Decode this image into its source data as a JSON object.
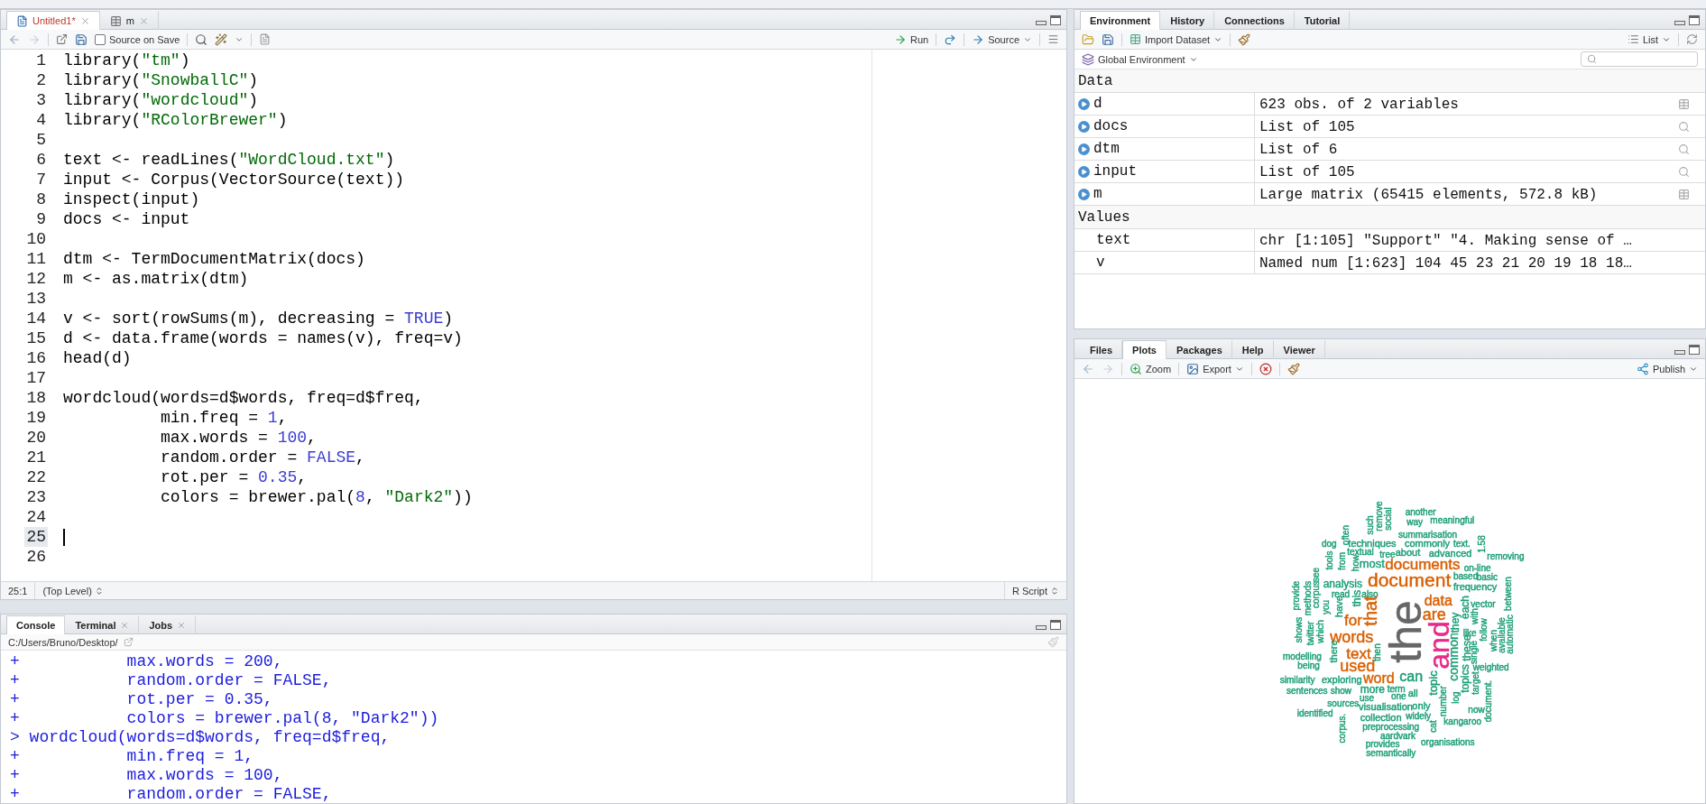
{
  "editor": {
    "tabs": [
      {
        "label": "Untitled1*",
        "kind": "script",
        "selected": true,
        "modified": true
      },
      {
        "label": "m",
        "kind": "data",
        "selected": false,
        "modified": false
      }
    ],
    "toolbar": {
      "source_on_save": {
        "label": "Source on Save",
        "checked": false
      },
      "run": "Run",
      "source": "Source"
    },
    "lines": [
      {
        "n": "1",
        "cursor": false,
        "tokens": [
          {
            "kind": "text",
            "text": "library("
          },
          {
            "kind": "string",
            "text": "\"tm\""
          },
          {
            "kind": "text",
            "text": ")"
          }
        ]
      },
      {
        "n": "2",
        "cursor": false,
        "tokens": [
          {
            "kind": "text",
            "text": "library("
          },
          {
            "kind": "string",
            "text": "\"SnowballC\""
          },
          {
            "kind": "text",
            "text": ")"
          }
        ]
      },
      {
        "n": "3",
        "cursor": false,
        "tokens": [
          {
            "kind": "text",
            "text": "library("
          },
          {
            "kind": "string",
            "text": "\"wordcloud\""
          },
          {
            "kind": "text",
            "text": ")"
          }
        ]
      },
      {
        "n": "4",
        "cursor": false,
        "tokens": [
          {
            "kind": "text",
            "text": "library("
          },
          {
            "kind": "string",
            "text": "\"RColorBrewer\""
          },
          {
            "kind": "text",
            "text": ")"
          }
        ]
      },
      {
        "n": "5",
        "cursor": false
      },
      {
        "n": "6",
        "cursor": false,
        "tokens": [
          {
            "kind": "text",
            "text": "text <- readLines("
          },
          {
            "kind": "string",
            "text": "\"WordCloud.txt\""
          },
          {
            "kind": "text",
            "text": ")"
          }
        ]
      },
      {
        "n": "7",
        "cursor": false,
        "tokens": [
          {
            "kind": "text",
            "text": "input <- Corpus(VectorSource(text))"
          }
        ]
      },
      {
        "n": "8",
        "cursor": false,
        "tokens": [
          {
            "kind": "text",
            "text": "inspect(input)"
          }
        ]
      },
      {
        "n": "9",
        "cursor": false,
        "tokens": [
          {
            "kind": "text",
            "text": "docs <- input"
          }
        ]
      },
      {
        "n": "10",
        "cursor": false
      },
      {
        "n": "11",
        "cursor": false,
        "tokens": [
          {
            "kind": "text",
            "text": "dtm <- TermDocumentMatrix(docs)"
          }
        ]
      },
      {
        "n": "12",
        "cursor": false,
        "tokens": [
          {
            "kind": "text",
            "text": "m <- as.matrix(dtm)"
          }
        ]
      },
      {
        "n": "13",
        "cursor": false
      },
      {
        "n": "14",
        "cursor": false,
        "tokens": [
          {
            "kind": "text",
            "text": "v <- sort(rowSums(m), decreasing = "
          },
          {
            "kind": "number",
            "text": "TRUE"
          },
          {
            "kind": "text",
            "text": ")"
          }
        ]
      },
      {
        "n": "15",
        "cursor": false,
        "tokens": [
          {
            "kind": "text",
            "text": "d <- data.frame(words = names(v), freq=v)"
          }
        ]
      },
      {
        "n": "16",
        "cursor": false,
        "tokens": [
          {
            "kind": "text",
            "text": "head(d)"
          }
        ]
      },
      {
        "n": "17",
        "cursor": false
      },
      {
        "n": "18",
        "cursor": false,
        "tokens": [
          {
            "kind": "text",
            "text": "wordcloud(words=d$words, freq=d$freq,"
          }
        ]
      },
      {
        "n": "19",
        "cursor": false,
        "tokens": [
          {
            "kind": "text",
            "text": "          min.freq = "
          },
          {
            "kind": "number",
            "text": "1"
          },
          {
            "kind": "text",
            "text": ","
          }
        ]
      },
      {
        "n": "20",
        "cursor": false,
        "tokens": [
          {
            "kind": "text",
            "text": "          max.words = "
          },
          {
            "kind": "number",
            "text": "100"
          },
          {
            "kind": "text",
            "text": ","
          }
        ]
      },
      {
        "n": "21",
        "cursor": false,
        "tokens": [
          {
            "kind": "text",
            "text": "          random.order = "
          },
          {
            "kind": "number",
            "text": "FALSE"
          },
          {
            "kind": "text",
            "text": ","
          }
        ]
      },
      {
        "n": "22",
        "cursor": false,
        "tokens": [
          {
            "kind": "text",
            "text": "          rot.per = "
          },
          {
            "kind": "number",
            "text": "0.35"
          },
          {
            "kind": "text",
            "text": ","
          }
        ]
      },
      {
        "n": "23",
        "cursor": false,
        "tokens": [
          {
            "kind": "text",
            "text": "          colors = brewer.pal("
          },
          {
            "kind": "number",
            "text": "8"
          },
          {
            "kind": "text",
            "text": ", "
          },
          {
            "kind": "string",
            "text": "\"Dark2\""
          },
          {
            "kind": "text",
            "text": "))"
          }
        ]
      },
      {
        "n": "24",
        "cursor": false
      },
      {
        "n": "25",
        "cursor": true
      },
      {
        "n": "26",
        "cursor": false
      }
    ],
    "status": {
      "position": "25:1",
      "scope": "(Top Level)",
      "file_type": "R Script"
    }
  },
  "console": {
    "tabs": [
      {
        "label": "Console",
        "selected": true,
        "closable": false
      },
      {
        "label": "Terminal",
        "selected": false,
        "closable": true
      },
      {
        "label": "Jobs",
        "selected": false,
        "closable": true
      }
    ],
    "path": "C:/Users/Bruno/Desktop/",
    "lines": [
      {
        "prompt": "+",
        "text": "          max.words = 200,"
      },
      {
        "prompt": "+",
        "text": "          random.order = FALSE,"
      },
      {
        "prompt": "+",
        "text": "          rot.per = 0.35,"
      },
      {
        "prompt": "+",
        "text": "          colors = brewer.pal(8, \"Dark2\"))"
      },
      {
        "prompt": ">",
        "text": "wordcloud(words=d$words, freq=d$freq,"
      },
      {
        "prompt": "+",
        "text": "          min.freq = 1,"
      },
      {
        "prompt": "+",
        "text": "          max.words = 100,"
      },
      {
        "prompt": "+",
        "text": "          random.order = FALSE,"
      }
    ]
  },
  "environment": {
    "tabs": [
      {
        "label": "Environment",
        "selected": true
      },
      {
        "label": "History",
        "selected": false
      },
      {
        "label": "Connections",
        "selected": false
      },
      {
        "label": "Tutorial",
        "selected": false
      }
    ],
    "import_dataset": "Import Dataset",
    "view_mode": "List",
    "scope": "Global Environment",
    "sections": [
      {
        "title": "Data",
        "rows": [
          {
            "name": "d",
            "value": "623 obs. of 2 variables",
            "expandable": true,
            "kind": "table"
          },
          {
            "name": "docs",
            "value": "List of 105",
            "expandable": true,
            "kind": "list"
          },
          {
            "name": "dtm",
            "value": "List of 6",
            "expandable": true,
            "kind": "list"
          },
          {
            "name": "input",
            "value": "List of 105",
            "expandable": true,
            "kind": "list"
          },
          {
            "name": "m",
            "value": "Large matrix (65415 elements, 572.8 kB)",
            "expandable": true,
            "kind": "table"
          }
        ]
      },
      {
        "title": "Values",
        "rows": [
          {
            "name": "text",
            "value": "chr [1:105] \"Support\" \"4. Making sense of …",
            "expandable": false,
            "kind": "plain"
          },
          {
            "name": "v",
            "value": "Named num [1:623] 104 45 23 21 20 19 18 18…",
            "expandable": false,
            "kind": "plain"
          }
        ]
      }
    ]
  },
  "plots": {
    "tabs": [
      {
        "label": "Files",
        "selected": false
      },
      {
        "label": "Plots",
        "selected": true
      },
      {
        "label": "Packages",
        "selected": false
      },
      {
        "label": "Help",
        "selected": false
      },
      {
        "label": "Viewer",
        "selected": false
      }
    ],
    "zoom": "Zoom",
    "export": "Export",
    "publish": "Publish",
    "wordcloud": [
      {
        "text": "remove",
        "color": "#1b9e77",
        "vertical": true
      },
      {
        "text": "social",
        "color": "#1b9e77",
        "vertical": true
      },
      {
        "text": "another",
        "color": "#1b9e77",
        "vertical": false
      },
      {
        "text": "such",
        "color": "#1b9e77",
        "vertical": true
      },
      {
        "text": "way",
        "color": "#1b9e77",
        "vertical": false
      },
      {
        "text": "meaningful",
        "color": "#1b9e77",
        "vertical": false
      },
      {
        "text": "often",
        "color": "#1b9e77",
        "vertical": true
      },
      {
        "text": "summarisation",
        "color": "#1b9e77",
        "vertical": false
      },
      {
        "text": "dog",
        "color": "#1b9e77",
        "vertical": false
      },
      {
        "text": "techniques",
        "color": "#1b9e77",
        "vertical": false
      },
      {
        "text": "commonly",
        "color": "#1b9e77",
        "vertical": false
      },
      {
        "text": "text.",
        "color": "#1b9e77",
        "vertical": false
      },
      {
        "text": "1.58",
        "color": "#1b9e77",
        "vertical": true
      },
      {
        "text": "tools",
        "color": "#1b9e77",
        "vertical": true
      },
      {
        "text": "textual",
        "color": "#1b9e77",
        "vertical": false
      },
      {
        "text": "about",
        "color": "#1b9e77",
        "vertical": false
      },
      {
        "text": "advanced",
        "color": "#1b9e77",
        "vertical": false
      },
      {
        "text": "from",
        "color": "#1b9e77",
        "vertical": true
      },
      {
        "text": "how",
        "color": "#1b9e77",
        "vertical": true
      },
      {
        "text": "most",
        "color": "#1b9e77",
        "vertical": false
      },
      {
        "text": "tree",
        "color": "#1b9e77",
        "vertical": false
      },
      {
        "text": "documents",
        "color": "#d95f02",
        "vertical": false
      },
      {
        "text": "removing",
        "color": "#1b9e77",
        "vertical": false
      },
      {
        "text": "on-line",
        "color": "#1b9e77",
        "vertical": false
      },
      {
        "text": "see",
        "color": "#1b9e77",
        "vertical": true
      },
      {
        "text": "document",
        "color": "#d95f02",
        "vertical": false
      },
      {
        "text": "based",
        "color": "#1b9e77",
        "vertical": false
      },
      {
        "text": "basic",
        "color": "#1b9e77",
        "vertical": false
      },
      {
        "text": "provide",
        "color": "#1b9e77",
        "vertical": true
      },
      {
        "text": "corpus",
        "color": "#1b9e77",
        "vertical": true
      },
      {
        "text": "analysis",
        "color": "#1b9e77",
        "vertical": false
      },
      {
        "text": "frequency",
        "color": "#1b9e77",
        "vertical": false
      },
      {
        "text": "between",
        "color": "#1b9e77",
        "vertical": true
      },
      {
        "text": "methods",
        "color": "#1b9e77",
        "vertical": true
      },
      {
        "text": "read",
        "color": "#1b9e77",
        "vertical": false
      },
      {
        "text": "this",
        "color": "#1b9e77",
        "vertical": true
      },
      {
        "text": "also",
        "color": "#1b9e77",
        "vertical": false
      },
      {
        "text": "that",
        "color": "#d95f02",
        "vertical": true
      },
      {
        "text": "the",
        "color": "#666666",
        "vertical": true
      },
      {
        "text": "data",
        "color": "#d95f02",
        "vertical": false
      },
      {
        "text": "you",
        "color": "#1b9e77",
        "vertical": true
      },
      {
        "text": "have",
        "color": "#1b9e77",
        "vertical": true
      },
      {
        "text": "each",
        "color": "#1b9e77",
        "vertical": true
      },
      {
        "text": "vector",
        "color": "#1b9e77",
        "vertical": false
      },
      {
        "text": "twitter",
        "color": "#1b9e77",
        "vertical": true
      },
      {
        "text": "for",
        "color": "#d95f02",
        "vertical": false
      },
      {
        "text": "are",
        "color": "#d95f02",
        "vertical": false
      },
      {
        "text": "they",
        "color": "#1b9e77",
        "vertical": true
      },
      {
        "text": "with",
        "color": "#1b9e77",
        "vertical": true
      },
      {
        "text": "shows",
        "color": "#1b9e77",
        "vertical": true
      },
      {
        "text": "which",
        "color": "#1b9e77",
        "vertical": true
      },
      {
        "text": "follow",
        "color": "#1b9e77",
        "vertical": true
      },
      {
        "text": "available",
        "color": "#1b9e77",
        "vertical": true
      },
      {
        "text": "automatic",
        "color": "#1b9e77",
        "vertical": true
      },
      {
        "text": "words",
        "color": "#d95f02",
        "vertical": false
      },
      {
        "text": "and",
        "color": "#e7298a",
        "vertical": true
      },
      {
        "text": "like",
        "color": "#1b9e77",
        "vertical": false
      },
      {
        "text": "there",
        "color": "#1b9e77",
        "vertical": true
      },
      {
        "text": "common",
        "color": "#1b9e77",
        "vertical": true
      },
      {
        "text": "these",
        "color": "#1b9e77",
        "vertical": true
      },
      {
        "text": "single",
        "color": "#1b9e77",
        "vertical": true
      },
      {
        "text": "when",
        "color": "#1b9e77",
        "vertical": true
      },
      {
        "text": "text",
        "color": "#d95f02",
        "vertical": false
      },
      {
        "text": "then",
        "color": "#1b9e77",
        "vertical": true
      },
      {
        "text": "modelling",
        "color": "#1b9e77",
        "vertical": false
      },
      {
        "text": "being",
        "color": "#1b9e77",
        "vertical": false
      },
      {
        "text": "used",
        "color": "#d95f02",
        "vertical": false
      },
      {
        "text": "topics",
        "color": "#1b9e77",
        "vertical": true
      },
      {
        "text": "weighted",
        "color": "#1b9e77",
        "vertical": false
      },
      {
        "text": "similarity",
        "color": "#1b9e77",
        "vertical": false
      },
      {
        "text": "exploring",
        "color": "#1b9e77",
        "vertical": false
      },
      {
        "text": "word",
        "color": "#d95f02",
        "vertical": false
      },
      {
        "text": "can",
        "color": "#1b9e77",
        "vertical": false
      },
      {
        "text": "topic",
        "color": "#1b9e77",
        "vertical": true
      },
      {
        "text": "target",
        "color": "#1b9e77",
        "vertical": true
      },
      {
        "text": "sentences",
        "color": "#1b9e77",
        "vertical": false
      },
      {
        "text": "show",
        "color": "#1b9e77",
        "vertical": false
      },
      {
        "text": "more",
        "color": "#1b9e77",
        "vertical": false
      },
      {
        "text": "term",
        "color": "#1b9e77",
        "vertical": false
      },
      {
        "text": "document.",
        "color": "#1b9e77",
        "vertical": true
      },
      {
        "text": "use",
        "color": "#1b9e77",
        "vertical": false
      },
      {
        "text": "one",
        "color": "#1b9e77",
        "vertical": false
      },
      {
        "text": "all",
        "color": "#1b9e77",
        "vertical": false
      },
      {
        "text": "number",
        "color": "#1b9e77",
        "vertical": true
      },
      {
        "text": "log",
        "color": "#1b9e77",
        "vertical": true
      },
      {
        "text": "sources",
        "color": "#1b9e77",
        "vertical": false
      },
      {
        "text": "visualisation",
        "color": "#1b9e77",
        "vertical": false
      },
      {
        "text": "only",
        "color": "#1b9e77",
        "vertical": false
      },
      {
        "text": "identified",
        "color": "#1b9e77",
        "vertical": false
      },
      {
        "text": "corpus.",
        "color": "#1b9e77",
        "vertical": true
      },
      {
        "text": "widely",
        "color": "#1b9e77",
        "vertical": false
      },
      {
        "text": "now",
        "color": "#1b9e77",
        "vertical": false
      },
      {
        "text": "collection",
        "color": "#1b9e77",
        "vertical": false
      },
      {
        "text": "cat",
        "color": "#1b9e77",
        "vertical": true
      },
      {
        "text": "kangaroo",
        "color": "#1b9e77",
        "vertical": false
      },
      {
        "text": "preprocessing",
        "color": "#1b9e77",
        "vertical": false
      },
      {
        "text": "aardvark",
        "color": "#1b9e77",
        "vertical": false
      },
      {
        "text": "organisations",
        "color": "#1b9e77",
        "vertical": false
      },
      {
        "text": "provides",
        "color": "#1b9e77",
        "vertical": false
      },
      {
        "text": "semantically",
        "color": "#1b9e77",
        "vertical": false
      }
    ]
  }
}
